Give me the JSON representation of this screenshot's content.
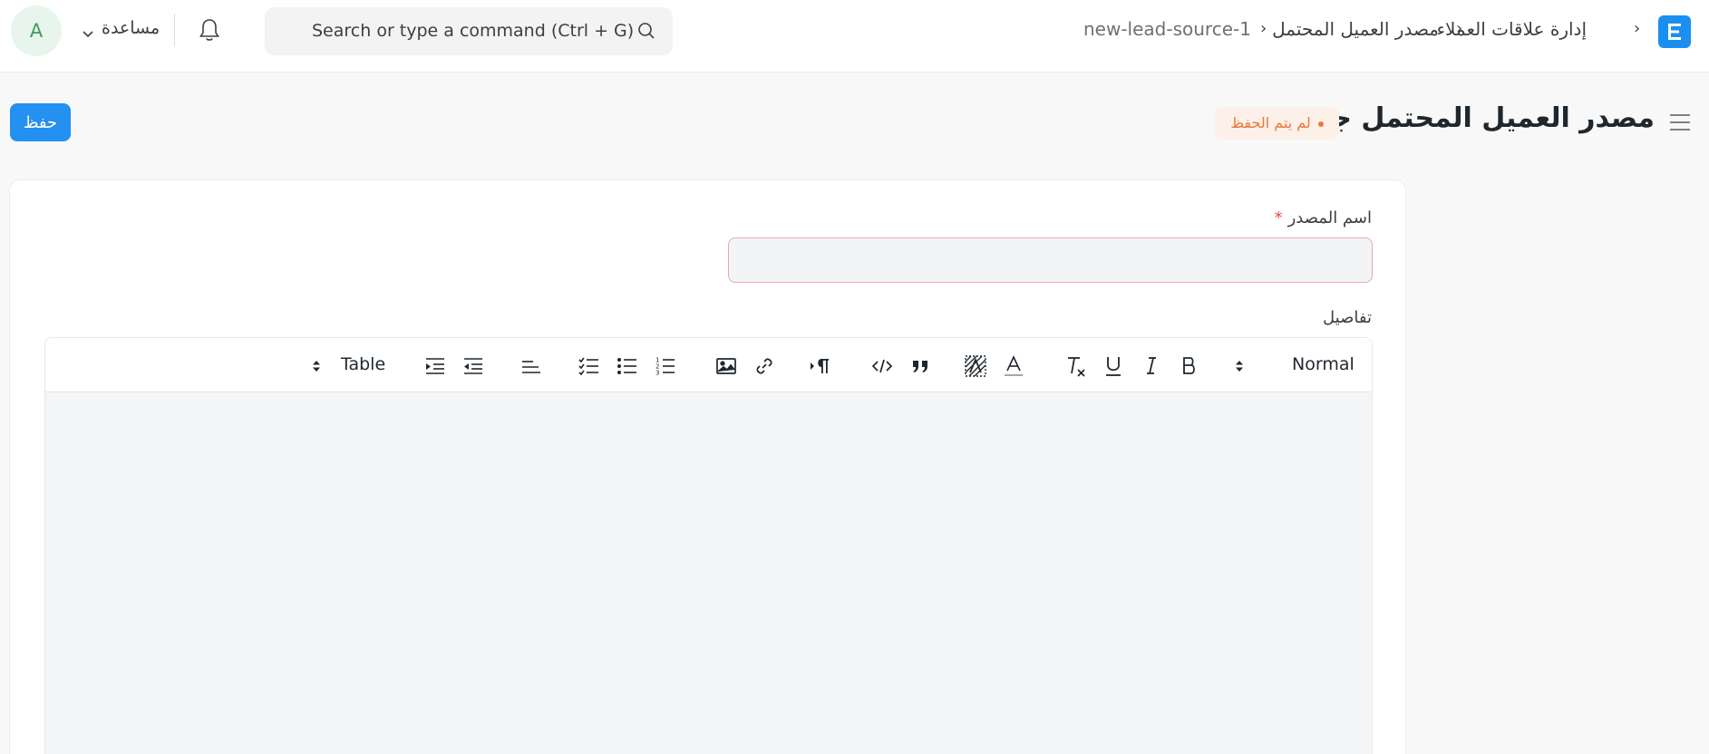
{
  "navbar": {
    "breadcrumbs": [
      "إدارة علاقات العملاء",
      "مصدر العميل المحتمل",
      "new-lead-source-1"
    ],
    "breadcrumb_separator": "›",
    "search": {
      "placeholder": "Search or type a command (Ctrl + G)"
    },
    "help_label": "مساعدة",
    "avatar_initial": "A"
  },
  "page": {
    "title": "مصدر العميل المحتمل جديد",
    "status": "لم يتم الحفظ",
    "save_label": "حفظ"
  },
  "form": {
    "source_name": {
      "label": "اسم المصدر",
      "required_mark": "*",
      "value": ""
    },
    "details": {
      "label": "تفاصيل"
    }
  },
  "toolbar": {
    "format_select": "Normal",
    "table_select": "Table",
    "icons": [
      "bold-icon",
      "italic-icon",
      "underline-icon",
      "clear-format-icon",
      "text-color-icon",
      "background-color-icon",
      "blockquote-icon",
      "code-block-icon",
      "text-direction-icon",
      "link-icon",
      "image-icon",
      "ordered-list-icon",
      "bullet-list-icon",
      "check-list-icon",
      "align-icon",
      "outdent-icon",
      "indent-icon"
    ]
  },
  "colors": {
    "primary": "#2490ef",
    "status_text": "#e8793a",
    "status_bg": "#fdf0e8",
    "required": "#e24c4c",
    "avatar_bg": "#e8f5ec",
    "avatar_text": "#3a9d5c"
  }
}
